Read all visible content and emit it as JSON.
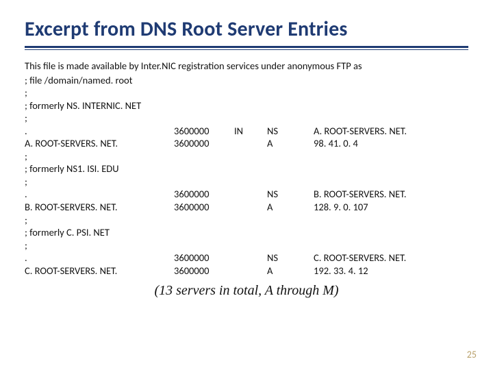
{
  "title": "Excerpt from DNS Root Server Entries",
  "intro": "This file is made available by Inter.NIC registration services under anonymous FTP as",
  "lines": [
    {
      "c1": "; file /domain/named. root"
    },
    {
      "c1": ";"
    },
    {
      "c1": "; formerly NS. INTERNIC. NET"
    },
    {
      "c1": ";"
    },
    {
      "c1": ".",
      "c2": "3600000",
      "c3": "IN",
      "c4": "NS",
      "c5": "A. ROOT-SERVERS. NET."
    },
    {
      "c1": "A. ROOT-SERVERS. NET.",
      "c2": "3600000",
      "c4": "A",
      "c5": "98. 41. 0. 4"
    },
    {
      "c1": ";"
    },
    {
      "c1": "; formerly NS1. ISI. EDU"
    },
    {
      "c1": ";"
    },
    {
      "c1": ".",
      "c2": "3600000",
      "c4": "NS",
      "c5": "B. ROOT-SERVERS. NET."
    },
    {
      "c1": "B. ROOT-SERVERS. NET.",
      "c2": "3600000",
      "c4": "A",
      "c5": "128. 9. 0. 107"
    },
    {
      "c1": ";"
    },
    {
      "c1": "; formerly C. PSI. NET"
    },
    {
      "c1": ";"
    },
    {
      "c1": ".",
      "c2": "3600000",
      "c4": "NS",
      "c5": "C. ROOT-SERVERS. NET."
    },
    {
      "c1": "C. ROOT-SERVERS. NET.",
      "c2": "3600000",
      "c4": "A",
      "c5": "192. 33. 4. 12"
    }
  ],
  "footnote": "(13 servers in total, A through M)",
  "pagenum": "25"
}
